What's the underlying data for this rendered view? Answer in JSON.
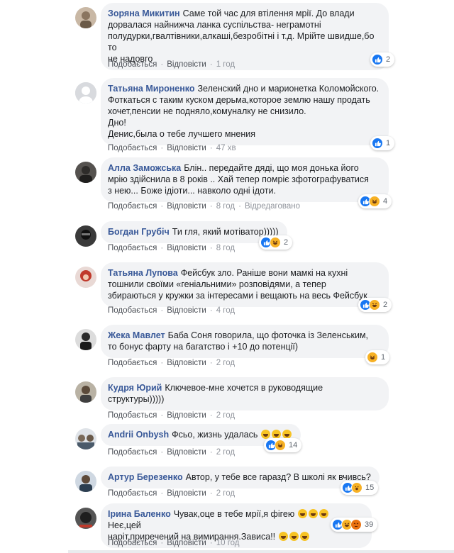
{
  "comments": [
    {
      "author": "Зоряна Микитин",
      "text": "Саме той час для втілення мрії. До влади\nдорвалася найнижча ланка суспільства- неграмотні\nполудурки,гвалтівники,алкаші,безробітні і т.д. Мрійте швидше,бо то\nне надовго",
      "like": "Подобається",
      "reply": "Відповісти",
      "time": "1 год",
      "reaction_count": "2",
      "reactions": [
        "like"
      ]
    },
    {
      "author": "Татьяна Мироненко",
      "text": "Зеленский дно и марионетка Коломойского.\nФоткаться с таким куском дерьма,которое землю нашу продать\nхочет,пенсии не подняло,комуналку не снизило.\nДно!\nДенис,была о тебе лучшего мнения",
      "like": "Подобається",
      "reply": "Відповісти",
      "time": "47 хв",
      "reaction_count": "1",
      "reactions": [
        "like"
      ]
    },
    {
      "author": "Алла Заможська",
      "text": "Блін.. передайте дяді, що моя донька його\nмрію здійснила в 8 років .. Хай тепер помріє зфотографуватися\nз нею... Боже ідіоти... навколо одні ідоти.",
      "like": "Подобається",
      "reply": "Відповісти",
      "time": "8 год",
      "edited": "Відредаговано",
      "reaction_count": "4",
      "reactions": [
        "like",
        "haha"
      ]
    },
    {
      "author": "Богдан Грубіч",
      "text": "Ти гля, який мотіватор)))))",
      "like": "Подобається",
      "reply": "Відповісти",
      "time": "8 год",
      "reaction_count": "2",
      "reactions": [
        "like",
        "haha"
      ]
    },
    {
      "author": "Татьяна Лупова",
      "text": "Фейсбук зло. Раніше вони мамкі на кухні\nтошнили своїми «геніальними» розповідями, а тепер\nзбираються у кружки за інтересами і вещають на весь Фейсбук",
      "like": "Подобається",
      "reply": "Відповісти",
      "time": "4 год",
      "reaction_count": "2",
      "reactions": [
        "like",
        "haha"
      ]
    },
    {
      "author": "Жека Мавлет",
      "text": "Баба Соня говорила, що фоточка із Зеленським,\nто бонус фарту на багатство і +10 до потенції)",
      "like": "Подобається",
      "reply": "Відповісти",
      "time": "2 год",
      "reaction_count": "1",
      "reactions": [
        "haha"
      ]
    },
    {
      "author": "Кудря Юрий",
      "text": "Ключевое-мне хочется в руководящие\nструктуры)))))",
      "like": "Подобається",
      "reply": "Відповісти",
      "time": "2 год",
      "reaction_count": "",
      "reactions": []
    },
    {
      "author": "Andrii Onbysh",
      "text": "Фсьо, жизнь удалась",
      "like": "Подобається",
      "reply": "Відповісти",
      "time": "2 год",
      "reaction_count": "14",
      "reactions": [
        "like",
        "haha"
      ]
    },
    {
      "author": "Артур Березенко",
      "text": "Автор, у тебе все гаразд? В школі як вчивсь?",
      "like": "Подобається",
      "reply": "Відповісти",
      "time": "2 год",
      "reaction_count": "15",
      "reactions": [
        "like",
        "wow"
      ]
    },
    {
      "author": "Ірина Баленко",
      "text": "Чувак,оце в тебе мрії,я фігею",
      "text2": "Неє,цей\nнаріт,приречений на вимирання.Зависа!!",
      "like": "Подобається",
      "reply": "Відповісти",
      "time": "10 год",
      "reaction_count": "39",
      "reactions": [
        "like",
        "haha",
        "angry"
      ]
    }
  ],
  "colors": {
    "author": "#385898",
    "bubble": "#f2f3f5",
    "like": "#1877f2",
    "haha": "#f7b125",
    "angry": "#e9710f"
  }
}
